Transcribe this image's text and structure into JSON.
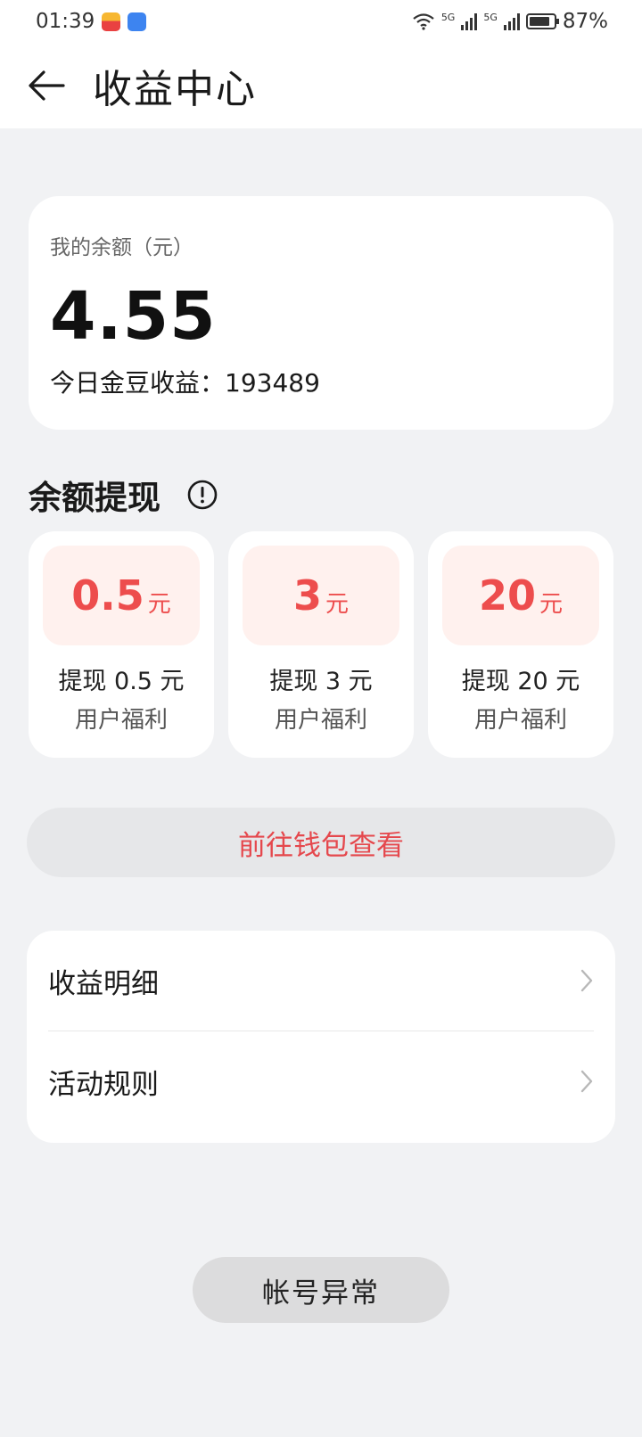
{
  "status_bar": {
    "time": "01:39",
    "signal1_label": "5G",
    "signal2_label": "5G",
    "battery": "87%"
  },
  "header": {
    "title": "收益中心",
    "back_icon": "arrow-left-icon"
  },
  "balance": {
    "label": "我的余额（元）",
    "value": "4.55",
    "today_label": "今日金豆收益：",
    "today_value": "193489"
  },
  "withdraw": {
    "title": "余额提现",
    "info_icon": "exclamation-circle-icon",
    "options": [
      {
        "amount": "0.5",
        "unit": "元",
        "title": "提现 0.5 元",
        "sub": "用户福利"
      },
      {
        "amount": "3",
        "unit": "元",
        "title": "提现 3 元",
        "sub": "用户福利"
      },
      {
        "amount": "20",
        "unit": "元",
        "title": "提现 20 元",
        "sub": "用户福利"
      }
    ]
  },
  "wallet_button": "前往钱包查看",
  "menu": [
    {
      "label": "收益明细"
    },
    {
      "label": "活动规则"
    }
  ],
  "anomaly_button": "帐号异常",
  "colors": {
    "accent_red": "#ed4d4d",
    "amount_bg": "#fff1ee",
    "page_bg": "#f1f2f4"
  }
}
